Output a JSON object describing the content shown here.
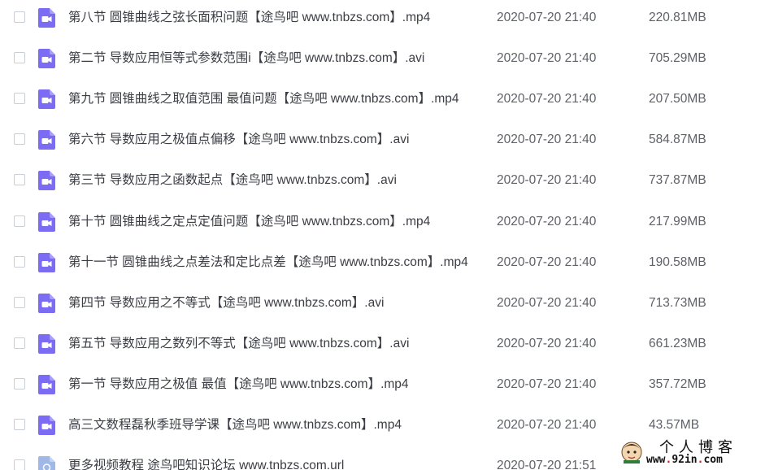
{
  "colors": {
    "video_icon": "#7c6cf3",
    "link_icon": "#9fb8e8",
    "text": "#3b3d44",
    "meta_text": "#5f6168",
    "checkbox_border": "#c9cdd4"
  },
  "files": [
    {
      "name": "第八节 圆锥曲线之弦长面积问题【途鸟吧 www.tnbzs.com】.mp4",
      "date": "2020-07-20 21:40",
      "size": "220.81MB",
      "icon": "video-file-icon"
    },
    {
      "name": "第二节 导数应用恒等式参数范围i【途鸟吧 www.tnbzs.com】.avi",
      "date": "2020-07-20 21:40",
      "size": "705.29MB",
      "icon": "video-file-icon"
    },
    {
      "name": "第九节 圆锥曲线之取值范围 最值问题【途鸟吧 www.tnbzs.com】.mp4",
      "date": "2020-07-20 21:40",
      "size": "207.50MB",
      "icon": "video-file-icon"
    },
    {
      "name": "第六节 导数应用之极值点偏移【途鸟吧 www.tnbzs.com】.avi",
      "date": "2020-07-20 21:40",
      "size": "584.87MB",
      "icon": "video-file-icon"
    },
    {
      "name": "第三节 导数应用之函数起点【途鸟吧 www.tnbzs.com】.avi",
      "date": "2020-07-20 21:40",
      "size": "737.87MB",
      "icon": "video-file-icon"
    },
    {
      "name": "第十节 圆锥曲线之定点定值问题【途鸟吧 www.tnbzs.com】.mp4",
      "date": "2020-07-20 21:40",
      "size": "217.99MB",
      "icon": "video-file-icon"
    },
    {
      "name": "第十一节 圆锥曲线之点差法和定比点差【途鸟吧 www.tnbzs.com】.mp4",
      "date": "2020-07-20 21:40",
      "size": "190.58MB",
      "icon": "video-file-icon"
    },
    {
      "name": "第四节 导数应用之不等式【途鸟吧 www.tnbzs.com】.avi",
      "date": "2020-07-20 21:40",
      "size": "713.73MB",
      "icon": "video-file-icon"
    },
    {
      "name": "第五节 导数应用之数列不等式【途鸟吧 www.tnbzs.com】.avi",
      "date": "2020-07-20 21:40",
      "size": "661.23MB",
      "icon": "video-file-icon"
    },
    {
      "name": "第一节 导数应用之极值 最值【途鸟吧 www.tnbzs.com】.mp4",
      "date": "2020-07-20 21:40",
      "size": "357.72MB",
      "icon": "video-file-icon"
    },
    {
      "name": "高三文数程磊秋季班导学课【途鸟吧 www.tnbzs.com】.mp4",
      "date": "2020-07-20 21:40",
      "size": "43.57MB",
      "icon": "video-file-icon"
    },
    {
      "name": "更多视频教程 途鸟吧知识论坛 www.tnbzs.com.url",
      "date": "2020-07-20 21:51",
      "size": "",
      "icon": "link-file-icon"
    }
  ],
  "watermark": {
    "title": "个人博客",
    "url_prefix": "www",
    "url_dot1": ".",
    "url_main": "92in",
    "url_dot2": ".",
    "url_suffix": "com",
    "avatar": "cartoon-avatar-icon"
  }
}
